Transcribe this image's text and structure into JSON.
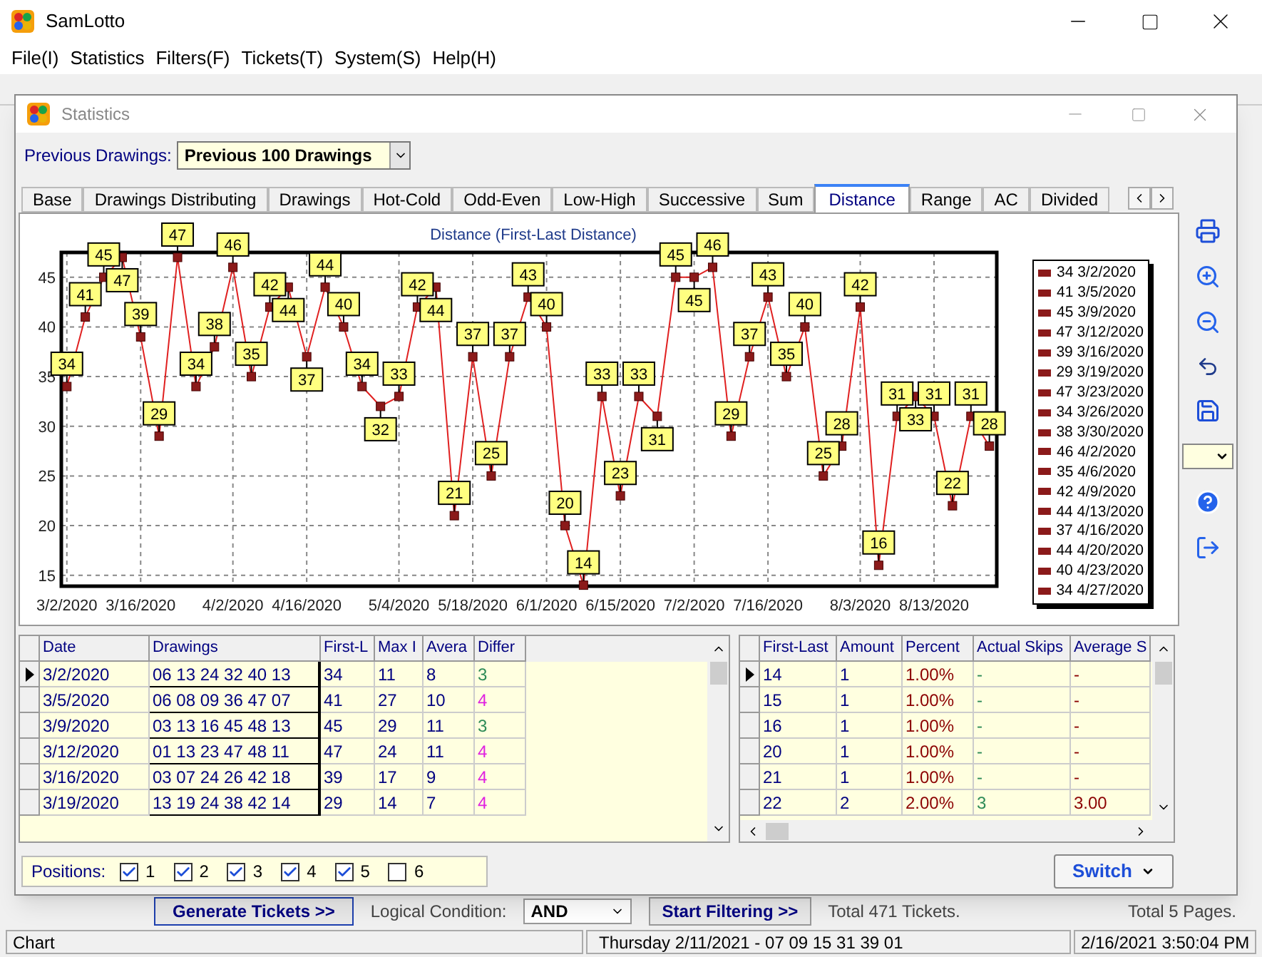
{
  "window": {
    "title": "SamLotto"
  },
  "menu": [
    "File(I)",
    "Statistics",
    "Filters(F)",
    "Tickets(T)",
    "System(S)",
    "Help(H)"
  ],
  "dialog": {
    "title": "Statistics",
    "previous_drawings": {
      "label": "Previous Drawings:",
      "value": "Previous 100 Drawings"
    },
    "tabs": [
      {
        "label": "Base",
        "selected": false
      },
      {
        "label": "Drawings Distributing",
        "selected": false
      },
      {
        "label": "Drawings",
        "selected": false
      },
      {
        "label": "Hot-Cold",
        "selected": false
      },
      {
        "label": "Odd-Even",
        "selected": false
      },
      {
        "label": "Low-High",
        "selected": false
      },
      {
        "label": "Successive",
        "selected": false
      },
      {
        "label": "Sum",
        "selected": false
      },
      {
        "label": "Distance",
        "selected": true
      },
      {
        "label": "Range",
        "selected": false
      },
      {
        "label": "AC",
        "selected": false
      },
      {
        "label": "Divided",
        "selected": false
      }
    ],
    "chart": {
      "chart_data": {
        "type": "line",
        "title": "Distance (First-Last Distance)",
        "categories": [
          "3/2/2020",
          null,
          null,
          null,
          "3/16/2020",
          null,
          null,
          null,
          null,
          "4/2/2020",
          null,
          null,
          null,
          "4/16/2020",
          null,
          null,
          null,
          null,
          "5/4/2020",
          null,
          null,
          null,
          "5/18/2020",
          null,
          null,
          null,
          "6/1/2020",
          null,
          null,
          null,
          "6/15/2020",
          null,
          null,
          null,
          "7/2/2020",
          null,
          null,
          null,
          "7/16/2020",
          null,
          null,
          null,
          null,
          "8/3/2020",
          null,
          null,
          null,
          "8/13/2020",
          null,
          null,
          null
        ],
        "series": [
          {
            "color": "#e02020",
            "marker": "square",
            "values": [
              34,
              41,
              45,
              47,
              39,
              29,
              47,
              34,
              38,
              46,
              35,
              42,
              44,
              37,
              44,
              40,
              34,
              32,
              33,
              42,
              44,
              21,
              37,
              25,
              37,
              43,
              40,
              20,
              14,
              33,
              23,
              33,
              31,
              45,
              45,
              46,
              29,
              37,
              43,
              35,
              40,
              25,
              28,
              42,
              16,
              31,
              33,
              31,
              22,
              31,
              28
            ]
          }
        ],
        "grid": true,
        "ylim": [
          13.9,
          47.5
        ],
        "yticks": [
          15,
          20,
          25,
          30,
          35,
          40,
          45
        ],
        "data_labels": true
      },
      "legend": [
        "34 3/2/2020",
        "41 3/5/2020",
        "45 3/9/2020",
        "47 3/12/2020",
        "39 3/16/2020",
        "29 3/19/2020",
        "47 3/23/2020",
        "34 3/26/2020",
        "38 3/30/2020",
        "46 4/2/2020",
        "35 4/6/2020",
        "42 4/9/2020",
        "44 4/13/2020",
        "37 4/16/2020",
        "44 4/20/2020",
        "40 4/23/2020",
        "34 4/27/2020"
      ]
    },
    "drawings_table": {
      "columns": [
        "Date",
        "Drawings",
        "First-L",
        "Max I",
        "Avera",
        "Differ"
      ],
      "rows": [
        {
          "selected": true,
          "cells": [
            "3/2/2020",
            "06 13 24 32 40 13",
            "34",
            "11",
            "8",
            "3"
          ],
          "color": "#2e8b57"
        },
        {
          "selected": false,
          "cells": [
            "3/5/2020",
            "06 08 09 36 47 07",
            "41",
            "27",
            "10",
            "4"
          ],
          "color": "#e020e0"
        },
        {
          "selected": false,
          "cells": [
            "3/9/2020",
            "03 13 16 45 48 13",
            "45",
            "29",
            "11",
            "3"
          ],
          "color": "#2e8b57"
        },
        {
          "selected": false,
          "cells": [
            "3/12/2020",
            "01 13 23 47 48 11",
            "47",
            "24",
            "11",
            "4"
          ],
          "color": "#e020e0"
        },
        {
          "selected": false,
          "cells": [
            "3/16/2020",
            "03 07 24 26 42 18",
            "39",
            "17",
            "9",
            "4"
          ],
          "color": "#e020e0"
        },
        {
          "selected": false,
          "cells": [
            "3/19/2020",
            "13 19 24 38 42 14",
            "29",
            "14",
            "7",
            "4"
          ],
          "color": "#e020e0"
        }
      ]
    },
    "summary_table": {
      "columns": [
        "First-Last",
        "Amount",
        "Percent",
        "Actual Skips",
        "Average S"
      ],
      "rows": [
        {
          "selected": true,
          "cells": [
            "14",
            "1",
            "1.00%",
            "-",
            "-"
          ]
        },
        {
          "selected": false,
          "cells": [
            "15",
            "1",
            "1.00%",
            "-",
            "-"
          ]
        },
        {
          "selected": false,
          "cells": [
            "16",
            "1",
            "1.00%",
            "-",
            "-"
          ]
        },
        {
          "selected": false,
          "cells": [
            "20",
            "1",
            "1.00%",
            "-",
            "-"
          ]
        },
        {
          "selected": false,
          "cells": [
            "21",
            "1",
            "1.00%",
            "-",
            "-"
          ]
        },
        {
          "selected": false,
          "cells": [
            "22",
            "2",
            "2.00%",
            "3",
            "3.00"
          ]
        }
      ]
    },
    "positions": {
      "label": "Positions:",
      "items": [
        {
          "label": "1",
          "checked": true
        },
        {
          "label": "2",
          "checked": true
        },
        {
          "label": "3",
          "checked": true
        },
        {
          "label": "4",
          "checked": true
        },
        {
          "label": "5",
          "checked": true
        },
        {
          "label": "6",
          "checked": false
        }
      ]
    },
    "switch_button": "Switch"
  },
  "bottom_bar": {
    "generate_button": "Generate Tickets >>",
    "logical_condition": {
      "label": "Logical Condition:",
      "value": "AND"
    },
    "filter_button": "Start Filtering >>",
    "tickets_total": "Total 471 Tickets.",
    "pages_total": "Total 5 Pages."
  },
  "status_bar": [
    "Chart",
    "Thursday 2/11/2021 - 07 09 15 31 39 01",
    "2/16/2021 3:50:04 PM"
  ]
}
